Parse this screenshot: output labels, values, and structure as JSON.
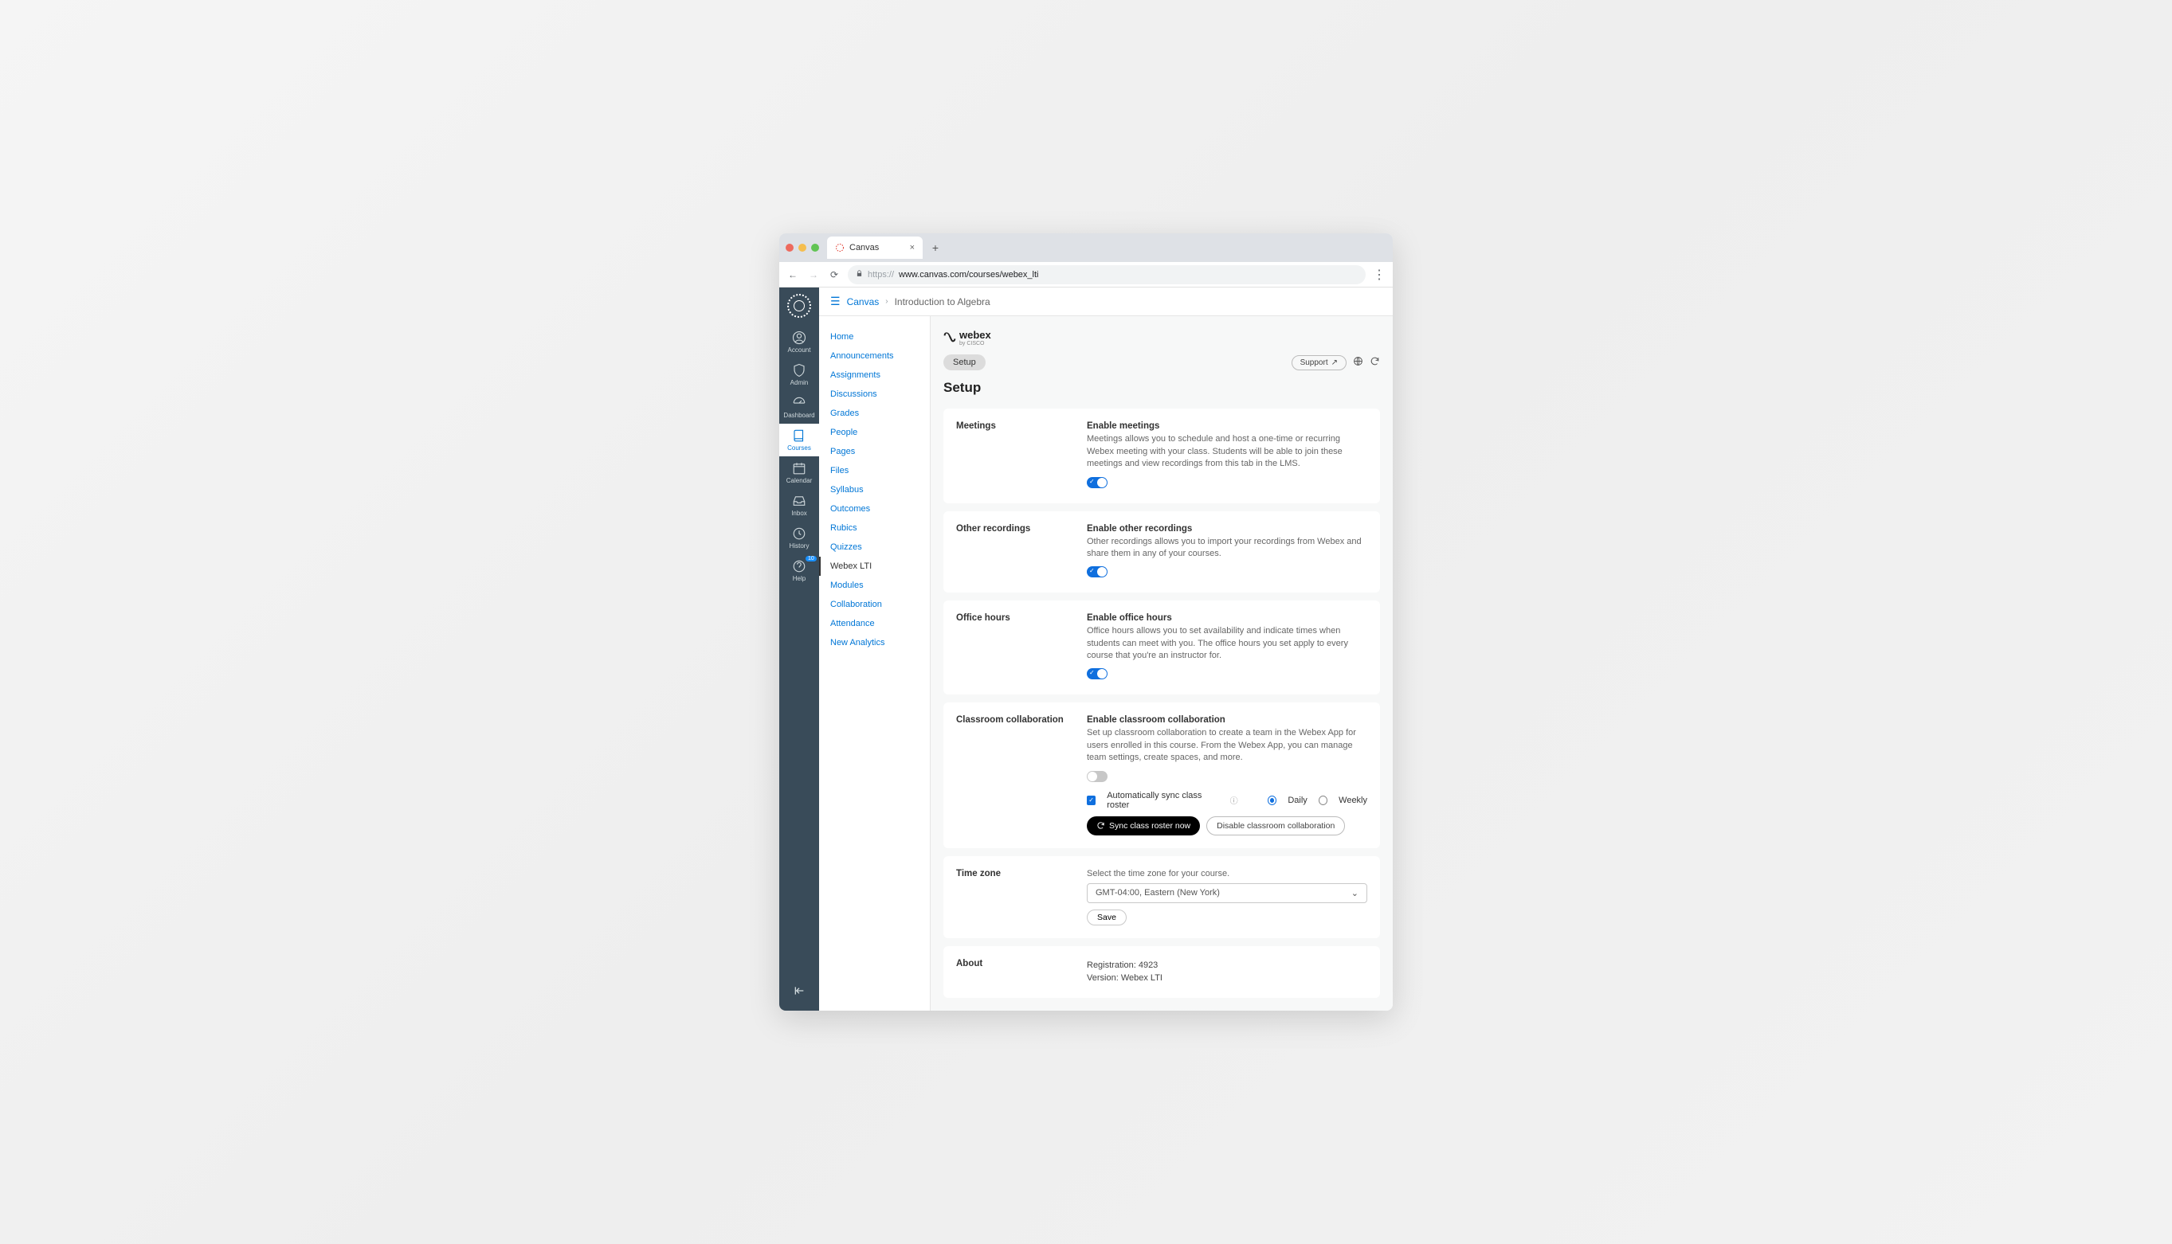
{
  "browser": {
    "tab_title": "Canvas",
    "url_prefix": "https://",
    "url_rest": "www.canvas.com/courses/webex_lti"
  },
  "breadcrumb": {
    "root": "Canvas",
    "current": "Introduction to Algebra"
  },
  "global_nav": {
    "items": [
      {
        "label": "Account",
        "icon": "account"
      },
      {
        "label": "Admin",
        "icon": "admin"
      },
      {
        "label": "Dashboard",
        "icon": "dashboard"
      },
      {
        "label": "Courses",
        "icon": "courses",
        "active": true
      },
      {
        "label": "Calendar",
        "icon": "calendar"
      },
      {
        "label": "Inbox",
        "icon": "inbox"
      },
      {
        "label": "History",
        "icon": "history"
      },
      {
        "label": "Help",
        "icon": "help",
        "badge": "10"
      }
    ]
  },
  "course_nav": {
    "items": [
      "Home",
      "Announcements",
      "Assignments",
      "Discussions",
      "Grades",
      "People",
      "Pages",
      "Files",
      "Syllabus",
      "Outcomes",
      "Rubics",
      "Quizzes",
      "Webex LTI",
      "Modules",
      "Collaboration",
      "Attendance",
      "New Analytics"
    ],
    "active": "Webex LTI"
  },
  "webex": {
    "brand": "webex",
    "brand_sub": "by CISCO",
    "setup_tab": "Setup",
    "support": "Support",
    "page_title": "Setup"
  },
  "sections": {
    "meetings": {
      "left": "Meetings",
      "title": "Enable meetings",
      "desc": "Meetings allows you to schedule and host a one-time or recurring Webex meeting with your class. Students will be able to join these meetings and view recordings from this tab in the LMS.",
      "toggle": true
    },
    "other_recordings": {
      "left": "Other recordings",
      "title": "Enable other recordings",
      "desc": "Other recordings allows you to import your recordings from Webex and share them in any of your courses.",
      "toggle": true
    },
    "office_hours": {
      "left": "Office hours",
      "title": "Enable office hours",
      "desc": "Office hours allows you to set availability and indicate times when students can meet with you. The office hours you set apply to every course that you're an instructor for.",
      "toggle": true
    },
    "classroom": {
      "left": "Classroom collaboration",
      "title": "Enable classroom collaboration",
      "desc": "Set up classroom collaboration to create a team in the Webex App for users enrolled in this course. From the Webex App, you can manage team settings, create spaces, and more.",
      "toggle": false,
      "auto_sync_label": "Automatically sync class roster",
      "radio_daily": "Daily",
      "radio_weekly": "Weekly",
      "btn_sync": "Sync class roster now",
      "btn_disable": "Disable classroom collaboration"
    },
    "timezone": {
      "left": "Time zone",
      "desc": "Select the time zone for your course.",
      "value": "GMT-04:00, Eastern (New York)",
      "save": "Save"
    },
    "about": {
      "left": "About",
      "registration_label": "Registration:",
      "registration_value": "4923",
      "version_label": "Version:",
      "version_value": "Webex LTI"
    }
  }
}
